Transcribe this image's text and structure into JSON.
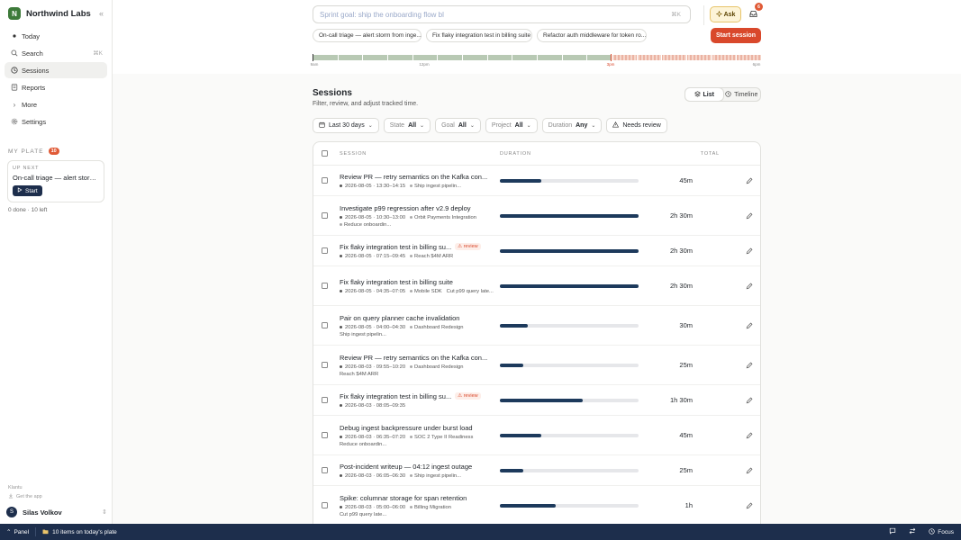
{
  "brand": {
    "initial": "N",
    "name": "Northwind Labs"
  },
  "nav": [
    {
      "label": "Today",
      "icon": "dot-icon"
    },
    {
      "label": "Search",
      "icon": "search-icon",
      "kbd": "⌘K"
    },
    {
      "label": "Sessions",
      "icon": "clock-icon",
      "active": true
    },
    {
      "label": "Reports",
      "icon": "reports-icon"
    },
    {
      "label": "More",
      "icon": "chevron-right-icon"
    },
    {
      "label": "Settings",
      "icon": "gear-icon"
    }
  ],
  "plate": {
    "heading": "MY PLATE",
    "count": "10",
    "upnext_label": "UP NEXT",
    "upnext_title": "On-call triage — alert storm from ingest",
    "start_label": "Start",
    "stats": "0 done · 10 left"
  },
  "sidebar_footer": {
    "brand": "Klantu",
    "get_app": "Get the app",
    "user_initial": "S",
    "user_name": "Silas Volkov"
  },
  "topbar": {
    "goal_placeholder": "Sprint goal: ship the onboarding flow bl",
    "goal_kbd": "⌘K",
    "ask_label": "Ask",
    "inbox_count": "6",
    "chips": [
      "On-call triage — alert storm from inge...",
      "Fix flaky integration test in billing suite",
      "Refactor auth middleware for token ro..."
    ],
    "start_session_label": "Start session",
    "timeline_labels": {
      "start": "9am",
      "mid": "12pm",
      "now": "3pm",
      "end": "6pm"
    },
    "timeline_progress": 0.665
  },
  "page": {
    "title": "Sessions",
    "subtitle": "Filter, review, and adjust tracked time.",
    "views": {
      "list": "List",
      "timeline": "Timeline"
    }
  },
  "filters": {
    "range": "Last 30 days",
    "state": {
      "label": "State",
      "value": "All"
    },
    "goal": {
      "label": "Goal",
      "value": "All"
    },
    "project": {
      "label": "Project",
      "value": "All"
    },
    "duration": {
      "label": "Duration",
      "value": "Any"
    },
    "review": "Needs review"
  },
  "table": {
    "headers": {
      "session": "SESSION",
      "duration": "DURATION",
      "total": "TOTAL"
    },
    "rows": [
      {
        "title": "Review PR — retry semantics on the Kafka con...",
        "meta": "2026-08-05 · 13:30–14:15",
        "tags": [
          "Ship ingest pipelin..."
        ],
        "progress": 0.3,
        "total": "45m",
        "h": 34
      },
      {
        "title": "Investigate p99 regression after v2.9 deploy",
        "meta": "2026-08-05 · 10:30–13:00",
        "tags": [
          "Orbit Payments Integration",
          "Reduce onboardin..."
        ],
        "progress": 1.0,
        "total": "2h 30m",
        "h": 44
      },
      {
        "title": "Fix flaky integration test in billing su...",
        "review": "review",
        "meta": "2026-08-05 · 07:15–09:45",
        "tags": [
          "Reach $4M ARR"
        ],
        "progress": 1.0,
        "total": "2h 30m",
        "h": 34
      },
      {
        "title": "Fix flaky integration test in billing suite",
        "meta": "2026-08-05 · 04:35–07:05",
        "tags": [
          "Mobile SDK",
          "Cut p99 query late..."
        ],
        "progress": 1.0,
        "total": "2h 30m",
        "h": 44
      },
      {
        "title": "Pair on query planner cache invalidation",
        "meta": "2026-08-05 · 04:00–04:30",
        "tags": [
          "Dashboard Redesign",
          "Ship ingest pipelin..."
        ],
        "progress": 0.2,
        "total": "30m",
        "h": 44
      },
      {
        "title": "Review PR — retry semantics on the Kafka con...",
        "meta": "2026-08-03 · 09:55–10:20",
        "tags": [
          "Dashboard Redesign",
          "Reach $4M ARR"
        ],
        "progress": 0.17,
        "total": "25m",
        "h": 44
      },
      {
        "title": "Fix flaky integration test in billing su...",
        "review": "review",
        "meta": "2026-08-03 · 08:05–09:35",
        "tags": [],
        "progress": 0.6,
        "total": "1h 30m",
        "h": 34
      },
      {
        "title": "Debug ingest backpressure under burst load",
        "meta": "2026-08-03 · 06:35–07:20",
        "tags": [
          "SOC 2 Type II Readiness",
          "Reduce onboardin..."
        ],
        "progress": 0.3,
        "total": "45m",
        "h": 44
      },
      {
        "title": "Post-incident writeup — 04:12 ingest outage",
        "meta": "2026-08-03 · 06:05–06:30",
        "tags": [
          "Ship ingest pipelin..."
        ],
        "progress": 0.17,
        "total": "25m",
        "h": 34
      },
      {
        "title": "Spike: columnar storage for span retention",
        "meta": "2026-08-03 · 05:00–06:00",
        "tags": [
          "Billing Migration",
          "Cut p99 query late..."
        ],
        "progress": 0.4,
        "total": "1h",
        "h": 44
      }
    ]
  },
  "bottombar": {
    "panel": "Panel",
    "plate": "10 items on today's plate",
    "focus": "Focus"
  },
  "colors": {
    "accent": "#d9482b",
    "navy": "#1d2e4c",
    "bar": "#1d3a5c",
    "brand_green": "#3d7a3a"
  }
}
